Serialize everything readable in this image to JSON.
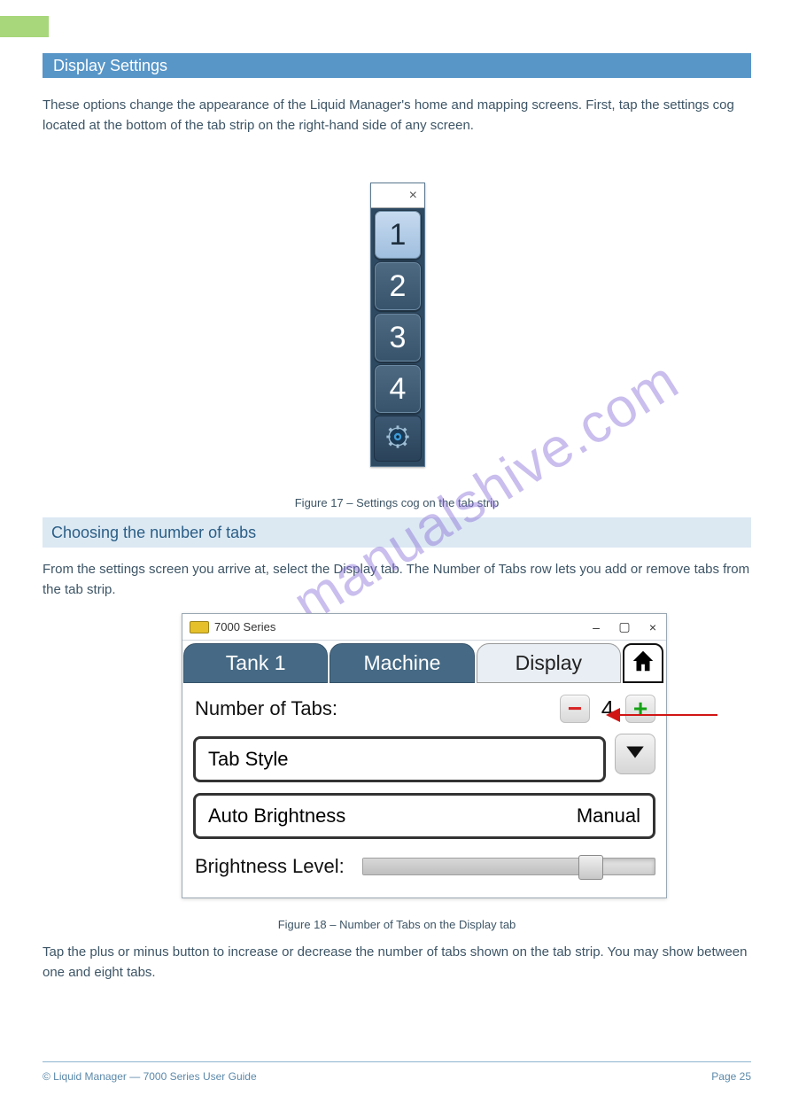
{
  "section": {
    "bar_title": "Display Settings",
    "intro": "These options change the appearance of the Liquid Manager's home and mapping screens. First, tap the settings cog located at the bottom of the tab strip on the right-hand side of any screen.",
    "tabstrip": {
      "close": "×",
      "tabs": [
        "1",
        "2",
        "3",
        "4"
      ],
      "caption": "Figure 17 – Settings cog on the tab strip"
    },
    "heading": "Choosing the number of tabs",
    "para2": "From the settings screen you arrive at, select the Display tab. The Number of Tabs row lets you add or remove tabs from the tab strip.",
    "window": {
      "title": "7000 Series",
      "win_buttons": {
        "min": "–",
        "max": "▢",
        "close": "×"
      },
      "tabs": [
        "Tank 1",
        "Machine",
        "Display"
      ],
      "rows": {
        "num_tabs_label": "Number of Tabs:",
        "num_tabs_value": "4",
        "tab_style_label": "Tab Style",
        "auto_brightness_label": "Auto Brightness",
        "auto_brightness_value": "Manual",
        "brightness_label": "Brightness Level:"
      }
    },
    "figcap2": "Figure 18 – Number of Tabs on the Display tab",
    "para3": "Tap the plus or minus button to increase or decrease the number of tabs shown on the tab strip. You may show between one and eight tabs.",
    "watermark": "manualshive.com"
  },
  "footer": {
    "left": "© Liquid Manager — 7000 Series User Guide",
    "right": "Page 25"
  }
}
